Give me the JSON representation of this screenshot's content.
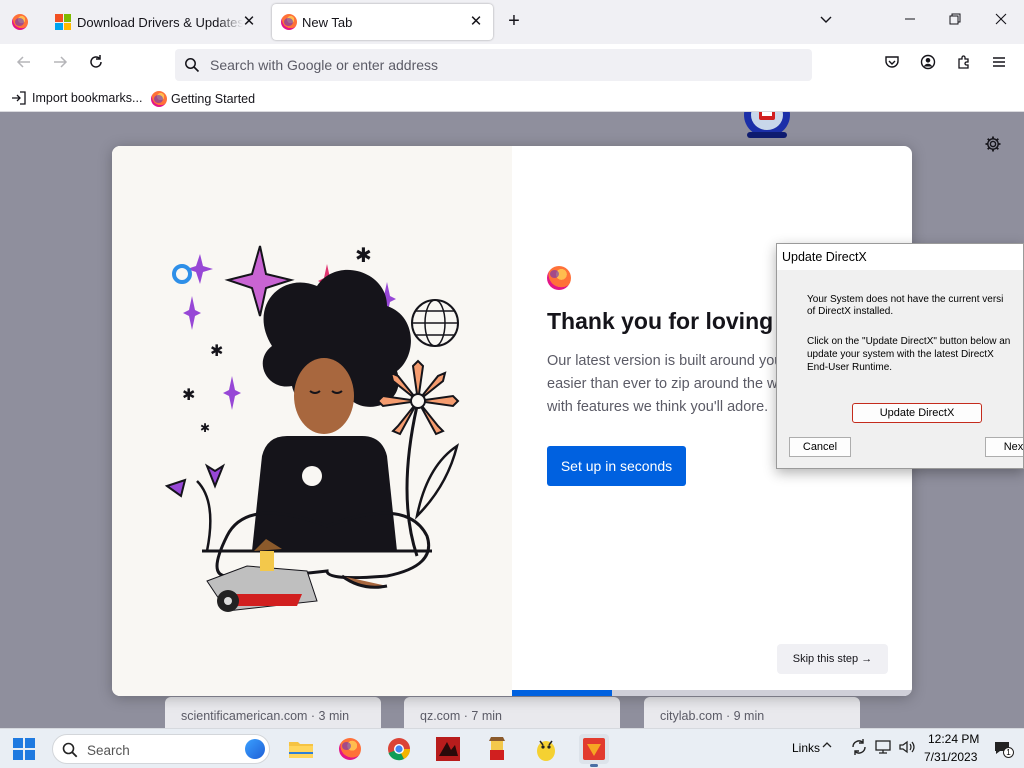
{
  "browser": {
    "tabs": [
      {
        "title": "Download Drivers & Updates for",
        "active": false
      },
      {
        "title": "New Tab",
        "active": true
      }
    ],
    "address_placeholder": "Search with Google or enter address",
    "bookmarks": [
      {
        "label": "Import bookmarks..."
      },
      {
        "label": "Getting Started"
      }
    ]
  },
  "onboarding": {
    "heading": "Thank you for loving F",
    "body": "Our latest version is built around you, easier than ever to zip around the w with features we think you'll adore.",
    "cta_label": "Set up in seconds",
    "skip_label": "Skip this step",
    "progress_fraction": 0.25
  },
  "top_sites": [
    {
      "label": "scientificamerican.com · 3 min"
    },
    {
      "label": "qz.com · 7 min"
    },
    {
      "label": "citylab.com · 9 min"
    }
  ],
  "directx_dialog": {
    "title": "Update DirectX",
    "line1": "Your System does not have the current versi",
    "line2": "of DirectX installed.",
    "line3": "Click on the \"Update DirectX\" button below an",
    "line4": "update your system with the latest DirectX",
    "line5": "End-User Runtime.",
    "update_label": "Update DirectX",
    "cancel_label": "Cancel",
    "next_label": "Next"
  },
  "taskbar": {
    "search_placeholder": "Search",
    "links_label": "Links",
    "time": "12:24 PM",
    "date": "7/31/2023",
    "notification_count": "1"
  },
  "colors": {
    "accent": "#0061e0",
    "content_backdrop": "#8f8f9d",
    "dialog_primary_border": "#c42b1c"
  }
}
